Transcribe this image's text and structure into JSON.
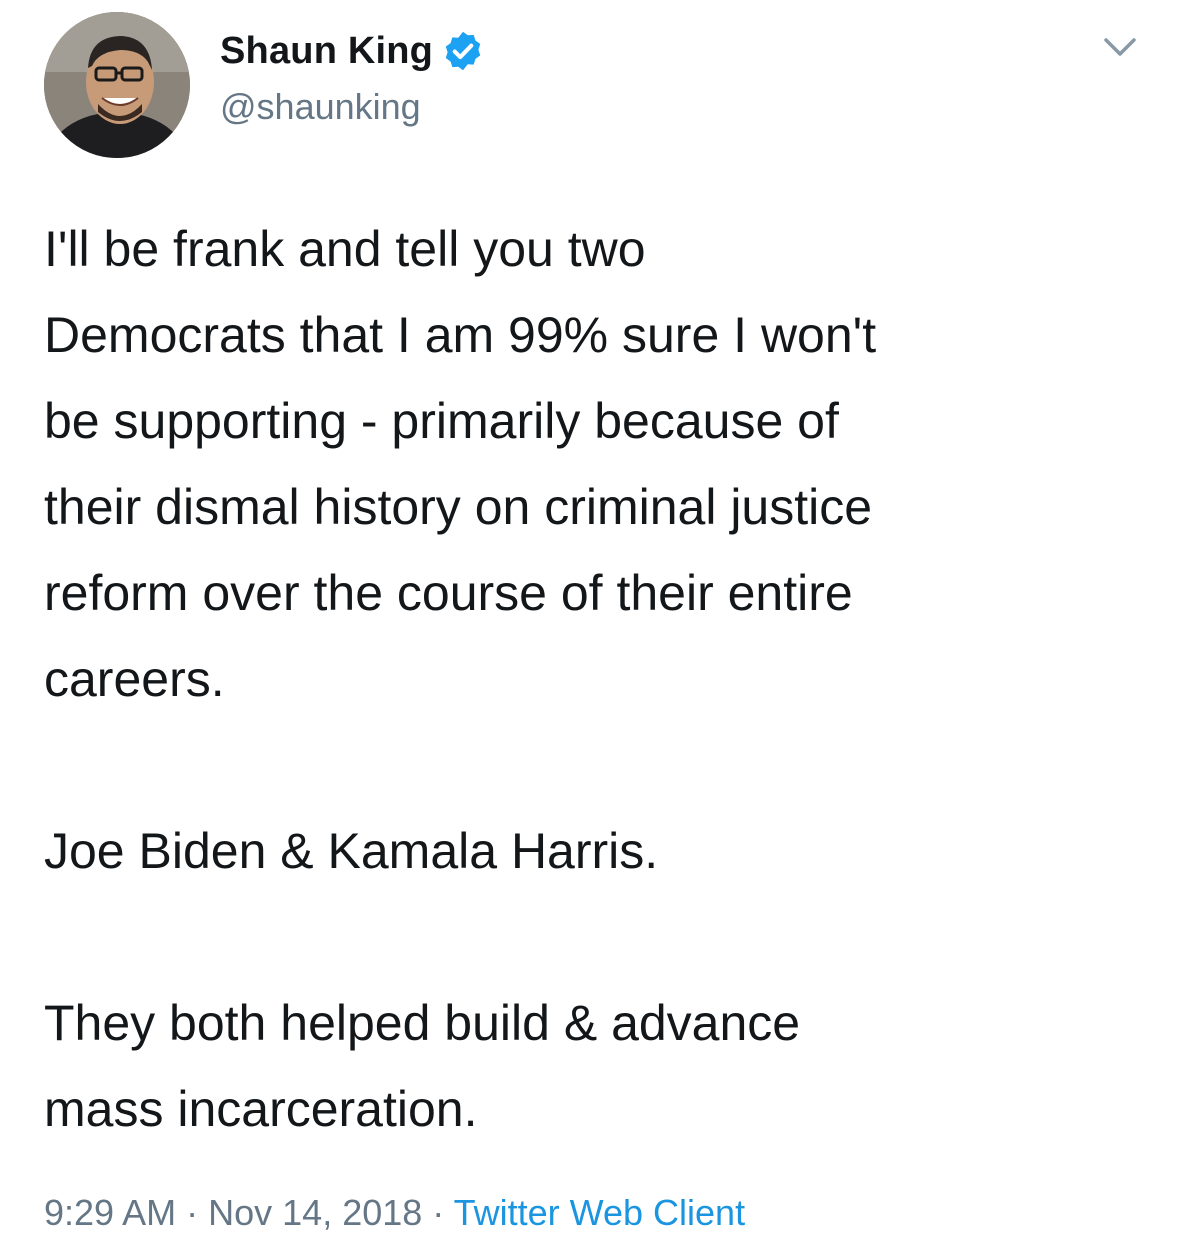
{
  "tweet": {
    "display_name": "Shaun King",
    "handle": "@shaunking",
    "verified": true,
    "verified_icon": "verified-badge-icon",
    "menu_icon": "chevron-down-icon",
    "paragraphs": [
      "I'll be frank and tell you two\nDemocrats that I am 99% sure I won't\nbe supporting - primarily because of\ntheir dismal history on criminal justice\nreform over the course of their entire\ncareers.",
      "Joe Biden & Kamala Harris.",
      "They both helped build & advance\nmass incarceration."
    ],
    "time": "9:29 AM",
    "date": "Nov 14, 2018",
    "separator": "·",
    "source": "Twitter Web Client"
  },
  "colors": {
    "text": "#14171a",
    "secondary": "#657786",
    "accent": "#1b95e0",
    "verified": "#1da1f2"
  }
}
